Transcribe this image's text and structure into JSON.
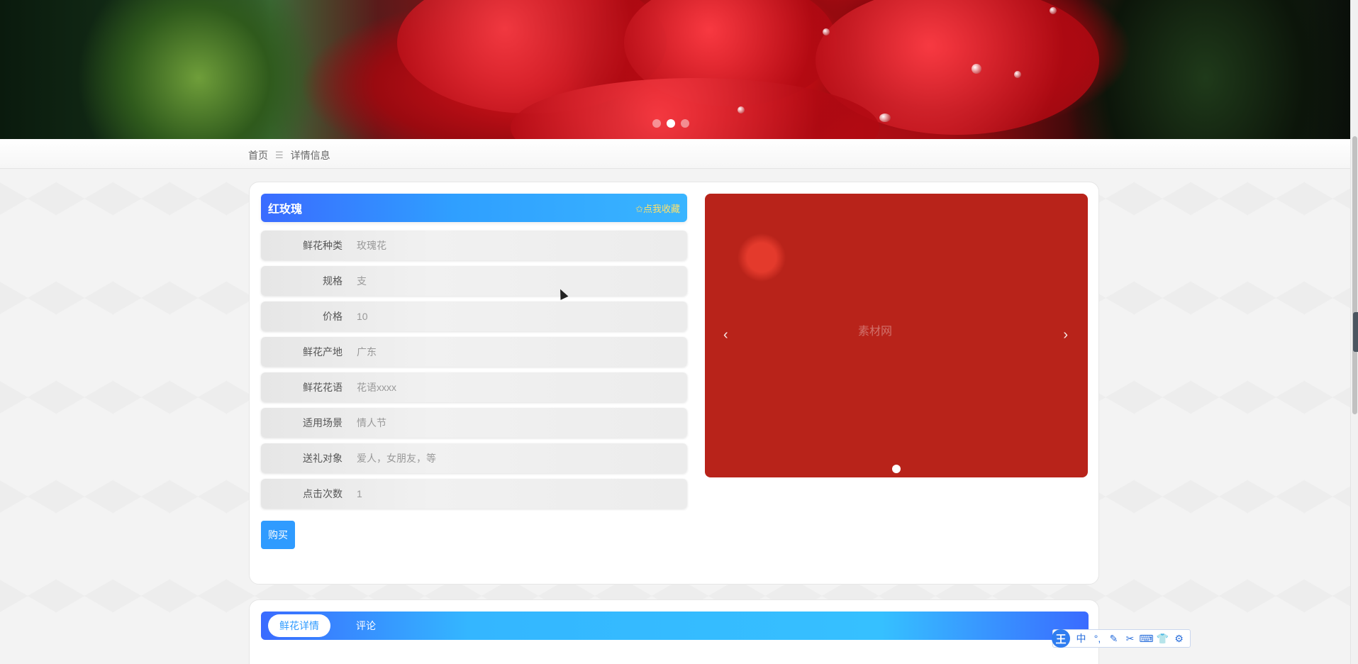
{
  "breadcrumb": {
    "home": "首页",
    "separator": "☰",
    "current": "详情信息"
  },
  "product": {
    "title": "红玫瑰",
    "favorite_label": "✩点我收藏",
    "fields": [
      {
        "label": "鲜花种类",
        "value": "玫瑰花"
      },
      {
        "label": "规格",
        "value": "支"
      },
      {
        "label": "价格",
        "value": "10"
      },
      {
        "label": "鲜花产地",
        "value": "广东"
      },
      {
        "label": "鲜花花语",
        "value": "花语xxxx"
      },
      {
        "label": "适用场景",
        "value": "情人节"
      },
      {
        "label": "送礼对象",
        "value": "爱人，女朋友，等"
      },
      {
        "label": "点击次数",
        "value": "1"
      }
    ],
    "buy_label": "购买"
  },
  "carousel": {
    "prev": "‹",
    "next": "›",
    "watermark": "素材网"
  },
  "tabs": [
    {
      "label": "鲜花详情",
      "active": true
    },
    {
      "label": "评论",
      "active": false
    }
  ],
  "ime": {
    "logo": "王",
    "buttons": [
      "中",
      "°,",
      "✎",
      "✂",
      "⌨",
      "👕",
      "⚙"
    ]
  },
  "colors": {
    "accent": "#2f9bff",
    "title_gradient_start": "#3a6bff",
    "favorite": "#ffe26a"
  }
}
